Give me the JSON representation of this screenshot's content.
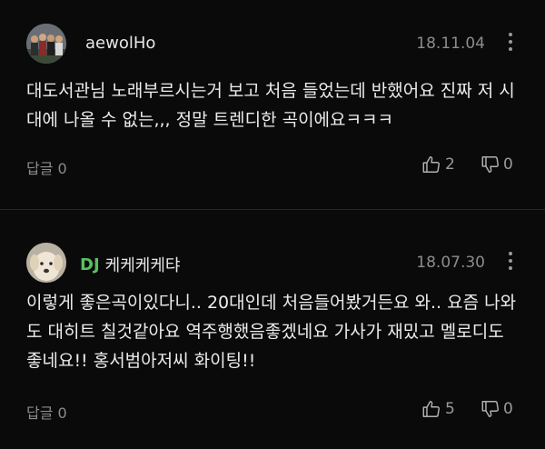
{
  "comments": [
    {
      "author": "aewolHo",
      "badge": "",
      "date": "18.11.04",
      "text": "대도서관님 노래부르시는거 보고 처음 들었는데 반했어요 진짜 저 시대에 나올 수 없는,,, 정말 트렌디한 곡이에요ㅋㅋㅋ",
      "reply_label": "답글 0",
      "likes": "2",
      "dislikes": "0",
      "avatar_icon": "group-photo-avatar"
    },
    {
      "author": "케케케케탸",
      "badge": "DJ",
      "date": "18.07.30",
      "text": "이렇게 좋은곡이있다니.. 20대인데 처음들어봤거든요 와.. 요즘 나와도 대히트 칠것같아요 역주행했음좋겠네요 가사가 재밌고 멜로디도 좋네요!! 홍서범아저씨 화이팅!!",
      "reply_label": "답글 0",
      "likes": "5",
      "dislikes": "0",
      "avatar_icon": "dog-photo-avatar"
    }
  ],
  "colors": {
    "background": "#0a0a0a",
    "text": "#ececec",
    "muted": "#8c8c8c",
    "badge": "#55c25e"
  },
  "icons": [
    "more-vertical-icon",
    "thumbs-up-icon",
    "thumbs-down-icon"
  ]
}
